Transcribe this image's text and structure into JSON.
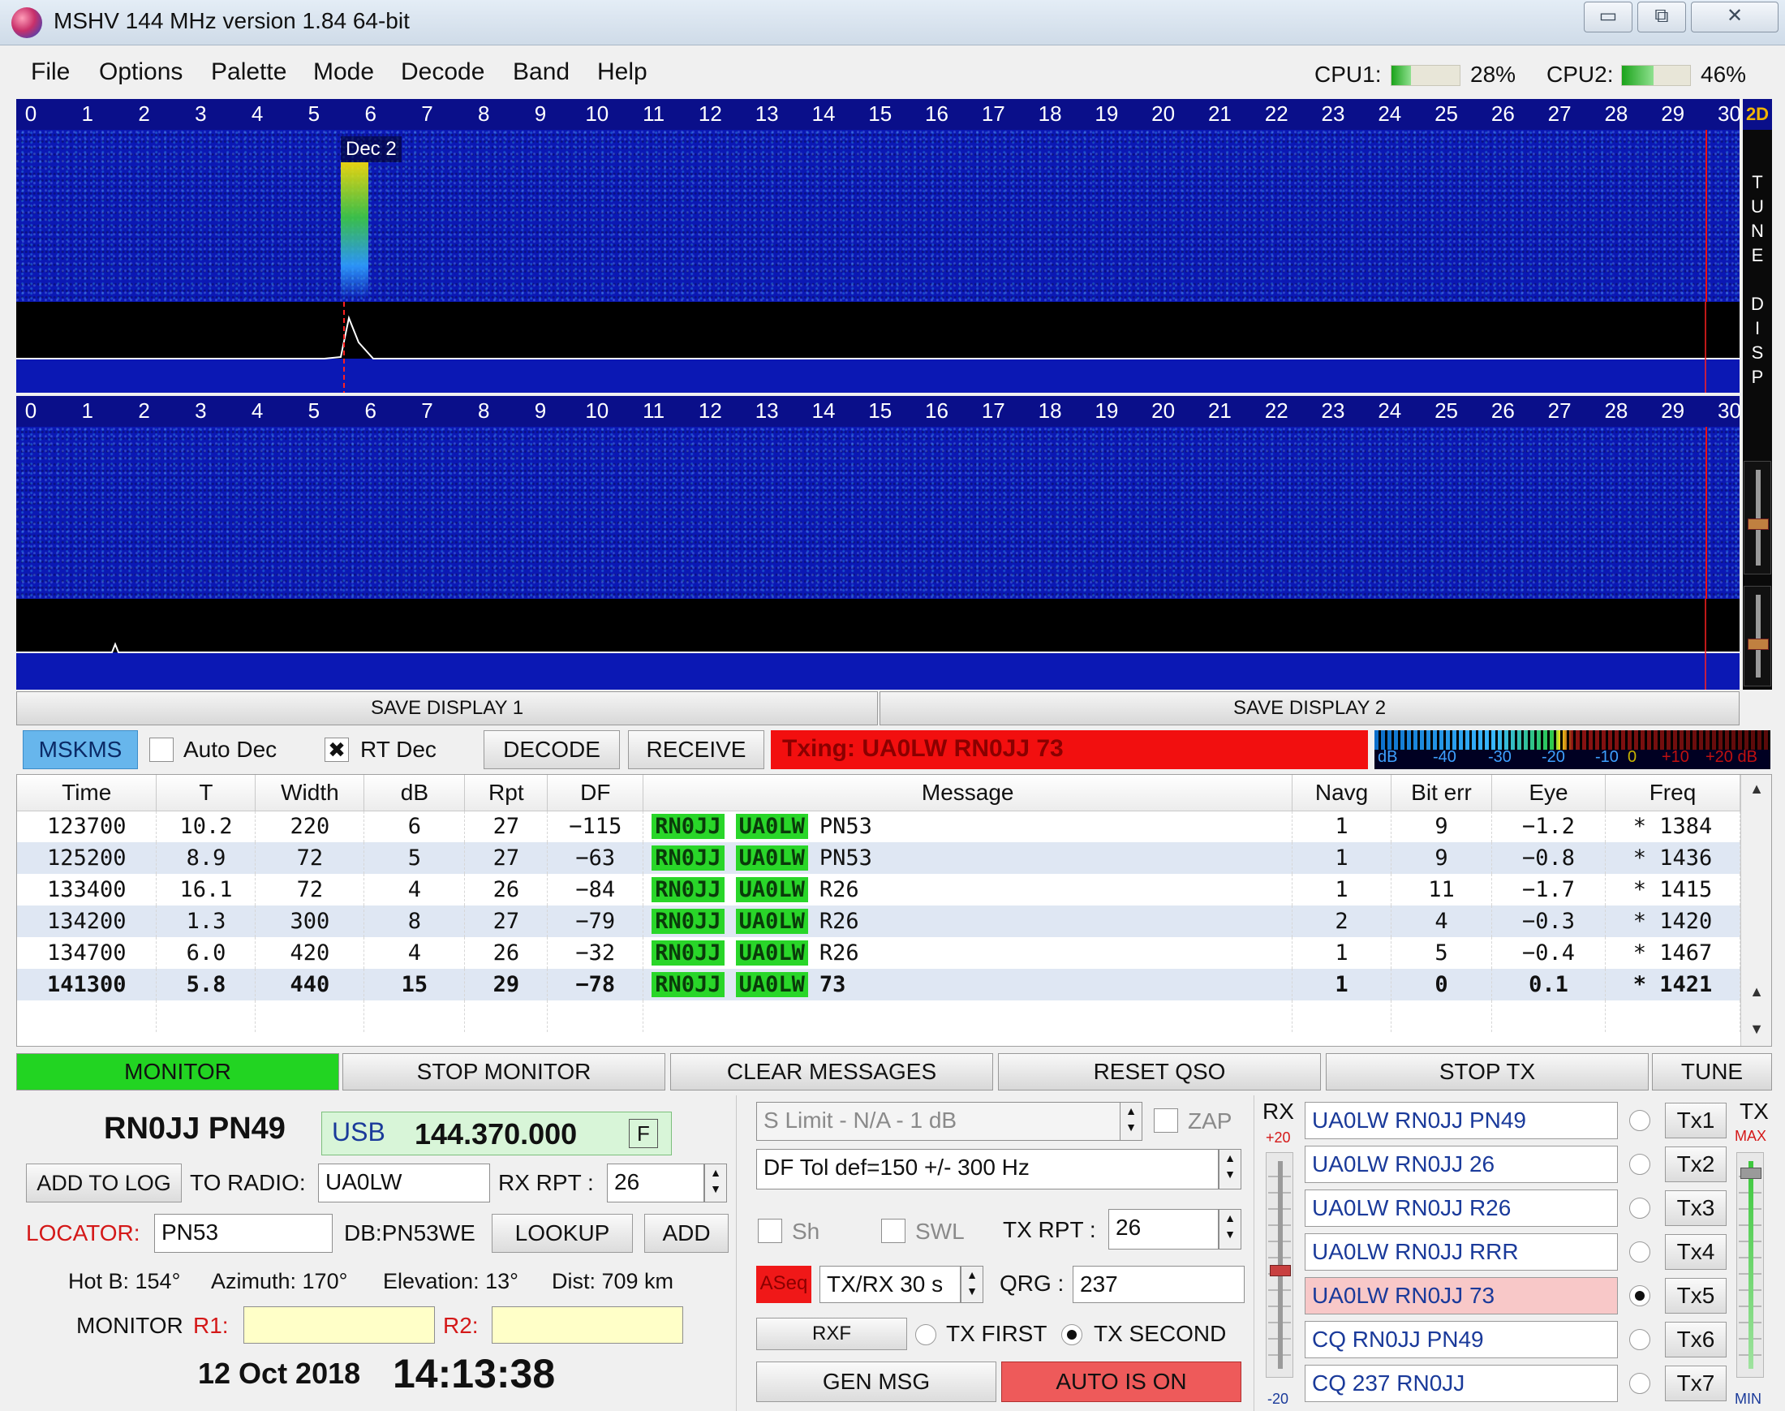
{
  "window": {
    "title": "MSHV 144 MHz version 1.84 64-bit",
    "controls": [
      "▭",
      "⧉",
      "✕"
    ]
  },
  "menu": [
    "File",
    "Options",
    "Palette",
    "Mode",
    "Decode",
    "Band",
    "Help"
  ],
  "cpu": {
    "cpu1_label": "CPU1:",
    "cpu1_value": "28%",
    "cpu1_level": 0.28,
    "cpu2_label": "CPU2:",
    "cpu2_value": "46%",
    "cpu2_level": 0.46
  },
  "display": {
    "scale_ticks": [
      "0",
      "1",
      "2",
      "3",
      "4",
      "5",
      "6",
      "7",
      "8",
      "9",
      "10",
      "11",
      "12",
      "13",
      "14",
      "15",
      "16",
      "17",
      "18",
      "19",
      "20",
      "21",
      "22",
      "23",
      "24",
      "25",
      "26",
      "27",
      "28",
      "29",
      "30"
    ],
    "decode_label": "Dec 2",
    "mode_2d": "2D",
    "side_text": [
      "T",
      "U",
      "N",
      "E",
      "",
      "D",
      "I",
      "S",
      "P"
    ],
    "save1": "SAVE DISPLAY 1",
    "save2": "SAVE DISPLAY 2"
  },
  "controls": {
    "mode_tab": "MSKMS",
    "auto_dec": "Auto Dec",
    "auto_dec_checked": false,
    "rt_dec": "RT Dec",
    "rt_dec_checked": true,
    "decode": "DECODE",
    "receive": "RECEIVE",
    "txing": "Txing: UA0LW RN0JJ 73",
    "meter_scale": [
      "dB",
      "-40",
      "-30",
      "-20",
      "-10",
      "0",
      "+10",
      "+20 dB"
    ]
  },
  "table": {
    "columns": [
      "Time",
      "T",
      "Width",
      "dB",
      "Rpt",
      "DF",
      "Message",
      "Navg",
      "Bit err",
      "Eye",
      "Freq"
    ],
    "rows": [
      {
        "time": "123700",
        "t": "10.2",
        "width": "220",
        "db": "6",
        "rpt": "27",
        "df": "−115",
        "call1": "RN0JJ",
        "call2": "UA0LW",
        "rest": "PN53",
        "navg": "1",
        "biterr": "9",
        "eye": "−1.2",
        "freq": "* 1384"
      },
      {
        "time": "125200",
        "t": "8.9",
        "width": "72",
        "db": "5",
        "rpt": "27",
        "df": "−63",
        "call1": "RN0JJ",
        "call2": "UA0LW",
        "rest": "PN53",
        "navg": "1",
        "biterr": "9",
        "eye": "−0.8",
        "freq": "* 1436"
      },
      {
        "time": "133400",
        "t": "16.1",
        "width": "72",
        "db": "4",
        "rpt": "26",
        "df": "−84",
        "call1": "RN0JJ",
        "call2": "UA0LW",
        "rest": "R26",
        "navg": "1",
        "biterr": "11",
        "eye": "−1.7",
        "freq": "* 1415"
      },
      {
        "time": "134200",
        "t": "1.3",
        "width": "300",
        "db": "8",
        "rpt": "27",
        "df": "−79",
        "call1": "RN0JJ",
        "call2": "UA0LW",
        "rest": "R26",
        "navg": "2",
        "biterr": "4",
        "eye": "−0.3",
        "freq": "* 1420"
      },
      {
        "time": "134700",
        "t": "6.0",
        "width": "420",
        "db": "4",
        "rpt": "26",
        "df": "−32",
        "call1": "RN0JJ",
        "call2": "UA0LW",
        "rest": "R26",
        "navg": "1",
        "biterr": "5",
        "eye": "−0.4",
        "freq": "* 1467"
      },
      {
        "time": "141300",
        "t": "5.8",
        "width": "440",
        "db": "15",
        "rpt": "29",
        "df": "−78",
        "call1": "RN0JJ",
        "call2": "UA0LW",
        "rest": "73",
        "navg": "1",
        "biterr": "0",
        "eye": "0.1",
        "freq": "* 1421"
      }
    ]
  },
  "buttons": {
    "monitor": "MONITOR",
    "stop_monitor": "STOP MONITOR",
    "clear_messages": "CLEAR MESSAGES",
    "reset_qso": "RESET QSO",
    "stop_tx": "STOP TX",
    "tune": "TUNE"
  },
  "station": {
    "callsign": "RN0JJ PN49",
    "mode": "USB",
    "frequency": "144.370.000",
    "f_btn": "F",
    "add_to_log": "ADD TO LOG",
    "to_radio_label": "TO RADIO:",
    "to_radio": "UA0LW",
    "rx_rpt_label": "RX RPT :",
    "rx_rpt": "26",
    "locator_label": "LOCATOR:",
    "locator": "PN53",
    "db_info": "DB:PN53WE",
    "lookup": "LOOKUP",
    "add": "ADD",
    "hot_b": "Hot B: 154°",
    "azimuth": "Azimuth: 170°",
    "elevation": "Elevation: 13°",
    "dist": "Dist: 709 km",
    "monitor_label": "MONITOR",
    "r1_label": "R1:",
    "r2_label": "R2:",
    "date": "12 Oct 2018",
    "time": "14:13:38"
  },
  "settings": {
    "s_limit": "S Limit - N/A - 1  dB",
    "zap": "ZAP",
    "df_tol": "DF Tol def=150 +/-  300  Hz",
    "sh": "Sh",
    "swl": "SWL",
    "tx_rpt_label": "TX RPT :",
    "tx_rpt": "26",
    "aseq": "ASeq",
    "txrx": "TX/RX 30  s",
    "qrg_label": "QRG :",
    "qrg": "237",
    "rxf": "RXF",
    "tx_first": "TX FIRST",
    "tx_second": "TX SECOND",
    "tx_second_selected": true,
    "gen_msg": "GEN MSG",
    "auto_on": "AUTO IS ON"
  },
  "rx_slider": {
    "label": "RX",
    "top": "+20",
    "bottom": "-20"
  },
  "tx_slider": {
    "label": "TX",
    "top": "MAX",
    "bottom": "MIN"
  },
  "tx_messages": [
    {
      "text": "UA0LW RN0JJ PN49",
      "btn": "Tx1",
      "selected": false
    },
    {
      "text": "UA0LW RN0JJ 26",
      "btn": "Tx2",
      "selected": false
    },
    {
      "text": "UA0LW RN0JJ R26",
      "btn": "Tx3",
      "selected": false
    },
    {
      "text": "UA0LW RN0JJ RRR",
      "btn": "Tx4",
      "selected": false
    },
    {
      "text": "UA0LW RN0JJ 73",
      "btn": "Tx5",
      "selected": true
    },
    {
      "text": "CQ RN0JJ PN49",
      "btn": "Tx6",
      "selected": false
    },
    {
      "text": "CQ 237 RN0JJ",
      "btn": "Tx7",
      "selected": false
    }
  ],
  "colors": {
    "monitor_on": "#22d422",
    "txing": "#f20f0f",
    "active_tx": "#f8c8c8",
    "auto_on": "#ee5a5a",
    "callsign_highlight": "#29d629"
  }
}
